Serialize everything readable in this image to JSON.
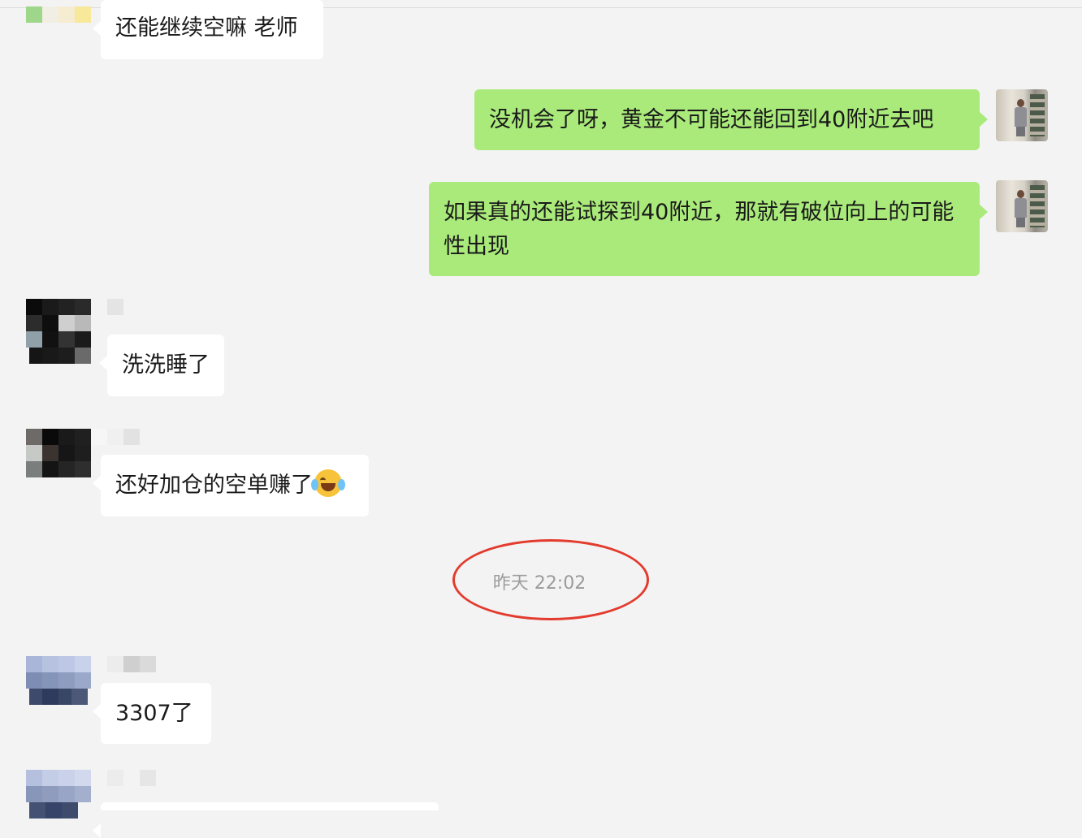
{
  "chat": {
    "messages": [
      {
        "side": "incoming",
        "text": "还能继续空嘛 老师"
      },
      {
        "side": "outgoing",
        "text": "没机会了呀，黄金不可能还能回到40附近去吧"
      },
      {
        "side": "outgoing",
        "text": "如果真的还能试探到40附近，那就有破位向上的可能性出现"
      },
      {
        "side": "incoming",
        "text": "洗洗睡了"
      },
      {
        "side": "incoming",
        "text": "还好加仓的空单赚了"
      },
      {
        "side": "incoming",
        "text": "3307了"
      }
    ],
    "timestamp": "昨天 22:02",
    "emoji": "laughing-crying-emoji",
    "colors": {
      "background": "#f3f3f3",
      "incoming_bubble": "#ffffff",
      "outgoing_bubble": "#a9ea7a",
      "annotation_circle": "#e33b2e",
      "timestamp_text": "#9b9b9b"
    }
  }
}
